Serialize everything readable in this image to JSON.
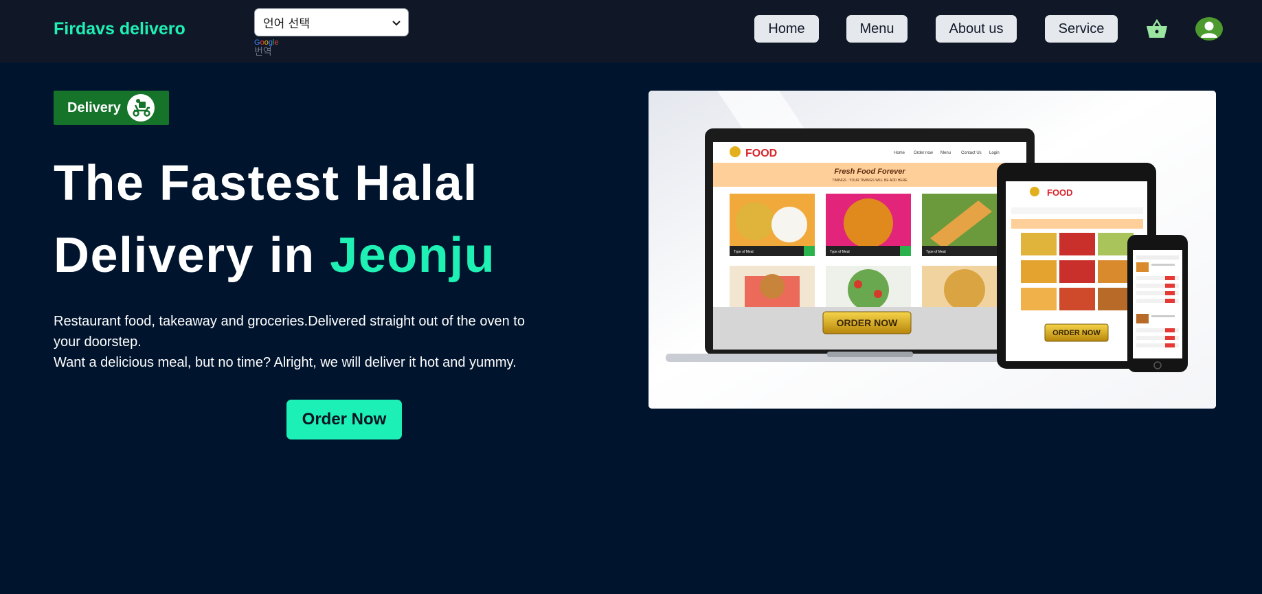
{
  "header": {
    "brand": "Firdavs delivero",
    "language_select": {
      "value": "언어 선택"
    },
    "powered_by": {
      "google": "Google",
      "translate": "번역"
    },
    "nav": [
      "Home",
      "Menu",
      "About us",
      "Service"
    ],
    "icons": {
      "cart": "basket-icon",
      "profile": "user-avatar-icon"
    }
  },
  "hero": {
    "badge": {
      "label": "Delivery",
      "icon": "delivery-scooter-icon"
    },
    "headline": {
      "line1": "The Fastest Halal",
      "line2_prefix": "Delivery in",
      "line2_accent": "Jeonju"
    },
    "description": [
      "Restaurant food, takeaway and groceries.Delivered straight out of the oven to your doorstep.",
      "Want a delicious meal, but no time? Alright, we will deliver it hot and yummy."
    ],
    "cta": "Order Now"
  },
  "mockup": {
    "laptop": {
      "logo": "FOOD",
      "nav": [
        "Home",
        "Order now",
        "Menu",
        "Contact Us",
        "Login"
      ],
      "banner": "Fresh Food Forever",
      "banner_sub": "TIMINGS : YOUR TIMINGS WILL BE ADD HERE",
      "item_label": "Type of Meal",
      "cta": "ORDER NOW"
    },
    "tablet": {
      "logo": "FOOD",
      "cta": "ORDER NOW"
    }
  },
  "colors": {
    "background": "#01142e",
    "header": "#101828",
    "accent": "#1ff0b4",
    "badge": "#15732a",
    "nav_button": "#e5e9ee"
  }
}
